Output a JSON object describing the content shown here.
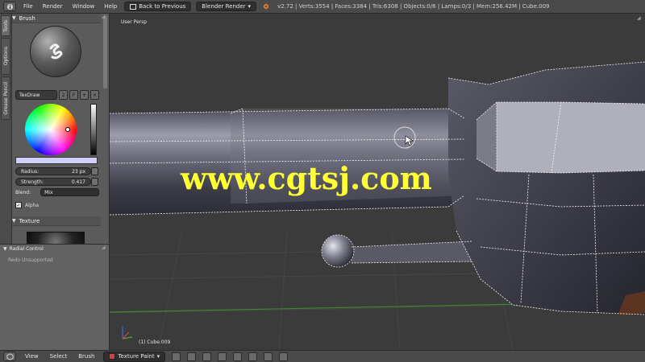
{
  "header": {
    "menus": [
      "File",
      "Render",
      "Window",
      "Help"
    ],
    "back_button": "Back to Previous",
    "render_engine": "Blender Render",
    "stats": "v2.72 | Verts:3554 | Faces:3384 | Tris:6308 | Objects:0/6 | Lamps:0/3 | Mem:256.42M | Cube.009"
  },
  "toolshelf": {
    "tabs": [
      "Tools",
      "Options",
      "Grease Pencil"
    ],
    "brush_panel": "Brush",
    "brush_name": "TexDraw",
    "brush_users": "2",
    "brush_fake_user": "F",
    "radius_label": "Radius:",
    "radius_value": "23 px",
    "strength_label": "Strength:",
    "strength_value": "0.417",
    "blend_label": "Blend:",
    "blend_value": "Mix",
    "alpha_label": "Alpha",
    "texture_panel": "Texture"
  },
  "redo_panel": {
    "title": "Radial Control",
    "placeholder": "Redo Unsupported"
  },
  "viewport": {
    "view_label": "User Persp",
    "object_label": "(1) Cube.009",
    "watermark": "www.cgtsj.com"
  },
  "footer": {
    "menus": [
      "View",
      "Select",
      "Brush"
    ],
    "mode": "Texture Paint"
  },
  "colors": {
    "brush_color": "#cfcffa",
    "watermark": "#ffff33",
    "selected_vertices": "#ffffff"
  }
}
